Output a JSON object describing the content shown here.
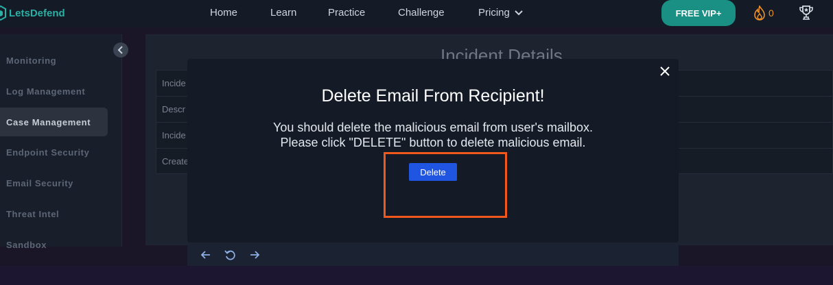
{
  "navbar": {
    "brand": "LetsDefend",
    "links": [
      {
        "label": "Home"
      },
      {
        "label": "Learn"
      },
      {
        "label": "Practice"
      },
      {
        "label": "Challenge"
      },
      {
        "label": "Pricing"
      }
    ],
    "vip_button": "FREE VIP+",
    "points": "0",
    "icons": [
      "logo-icon",
      "chevron-down-icon",
      "fire-icon",
      "trophy-icon"
    ]
  },
  "sidebar": {
    "items": [
      {
        "label": "Monitoring"
      },
      {
        "label": "Log Management"
      },
      {
        "label": "Case Management",
        "active": true
      },
      {
        "label": "Endpoint Security"
      },
      {
        "label": "Email Security"
      },
      {
        "label": "Threat Intel"
      },
      {
        "label": "Sandbox"
      }
    ]
  },
  "background": {
    "title": "Incident Details",
    "rows": [
      "Incide",
      "Descr",
      "Incide",
      "Create"
    ]
  },
  "modal": {
    "title": "Delete Email From Recipient!",
    "message_line1": "You should delete the malicious email from user's mailbox.",
    "message_line2": "Please click \"DELETE\" button to delete malicious email.",
    "delete_button": "Delete"
  },
  "toolbar": {
    "icons": [
      "arrow-left-icon",
      "refresh-icon",
      "arrow-right-icon"
    ]
  },
  "colors": {
    "accent": "#1a8f84",
    "brand_text": "#2ab0a4",
    "delete_button": "#1f55e0",
    "highlight": "#f2581c",
    "points": "#f0922b"
  }
}
